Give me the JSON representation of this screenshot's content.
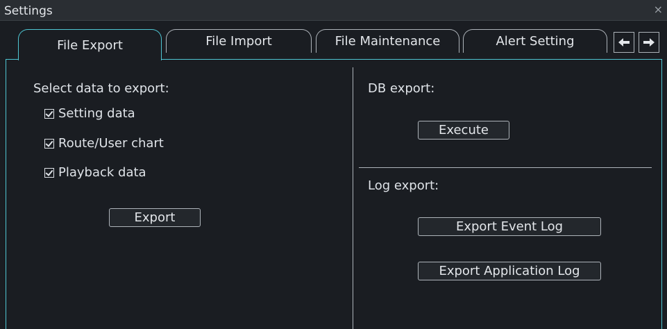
{
  "window": {
    "title": "Settings",
    "close_glyph": "×"
  },
  "tabs": [
    {
      "label": "File Export",
      "active": true
    },
    {
      "label": "File Import",
      "active": false
    },
    {
      "label": "File Maintenance",
      "active": false
    },
    {
      "label": "Alert Setting",
      "active": false
    }
  ],
  "tab_nav": {
    "prev_icon": "arrow-left-icon",
    "next_icon": "arrow-right-icon"
  },
  "export": {
    "heading": "Select data to export:",
    "options": [
      {
        "label": "Setting data",
        "checked": true
      },
      {
        "label": "Route/User chart",
        "checked": true
      },
      {
        "label": "Playback data",
        "checked": true
      }
    ],
    "button": "Export"
  },
  "db_export": {
    "heading": "DB export:",
    "button": "Execute"
  },
  "log_export": {
    "heading": "Log export:",
    "event_button": "Export Event Log",
    "app_button": "Export Application Log"
  },
  "colors": {
    "background": "#1a1d22",
    "accent": "#4fc6d3",
    "text": "#dfe3e8"
  }
}
